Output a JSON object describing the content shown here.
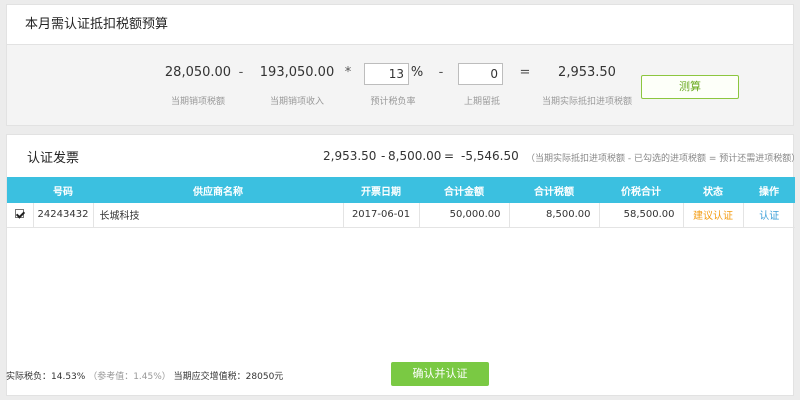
{
  "budget": {
    "title": "本月需认证抵扣税额预算",
    "output_tax": "28,050.00",
    "output_tax_label": "当期销项税额",
    "op_minus1": "-",
    "sales_income": "193,050.00",
    "sales_income_label": "当期销项收入",
    "op_mult": "*",
    "tax_rate_value": "13",
    "tax_rate_unit": "%",
    "tax_rate_label": "预计税负率",
    "op_minus2": "-",
    "prev_retained_value": "0",
    "prev_retained_label": "上期留抵",
    "op_eq": "=",
    "result": "2,953.50",
    "result_label": "当期实际抵扣进项税额",
    "calc_button": "测算"
  },
  "invoices": {
    "title": "认证发票",
    "eq_a": "2,953.50",
    "eq_op1": "-",
    "eq_b": "8,500.00",
    "eq_op2": "=",
    "eq_c": "-5,546.50",
    "eq_note": "（当期实际抵扣进项税额 - 已勾选的进项税额 = 预计还需进项税额）",
    "columns": [
      "号码",
      "供应商名称",
      "开票日期",
      "合计金额",
      "合计税额",
      "价税合计",
      "状态",
      "操作"
    ],
    "rows": [
      {
        "checked": true,
        "number": "24243432",
        "supplier": "长城科技",
        "date": "2017-06-01",
        "amount": "50,000.00",
        "tax": "8,500.00",
        "total": "58,500.00",
        "status": "建议认证",
        "action": "认证"
      }
    ]
  },
  "footer": {
    "actual_rate": "实际税负：14.53%",
    "ref_rate": "（参考值：1.45%）",
    "vat_due": "当期应交增值税：28050元",
    "confirm_button": "确认并认证"
  },
  "colors": {
    "header_bg": "#3bc0e0",
    "accent_green": "#7ac943",
    "status_orange": "#f39c12",
    "link_blue": "#3b9fd8"
  }
}
